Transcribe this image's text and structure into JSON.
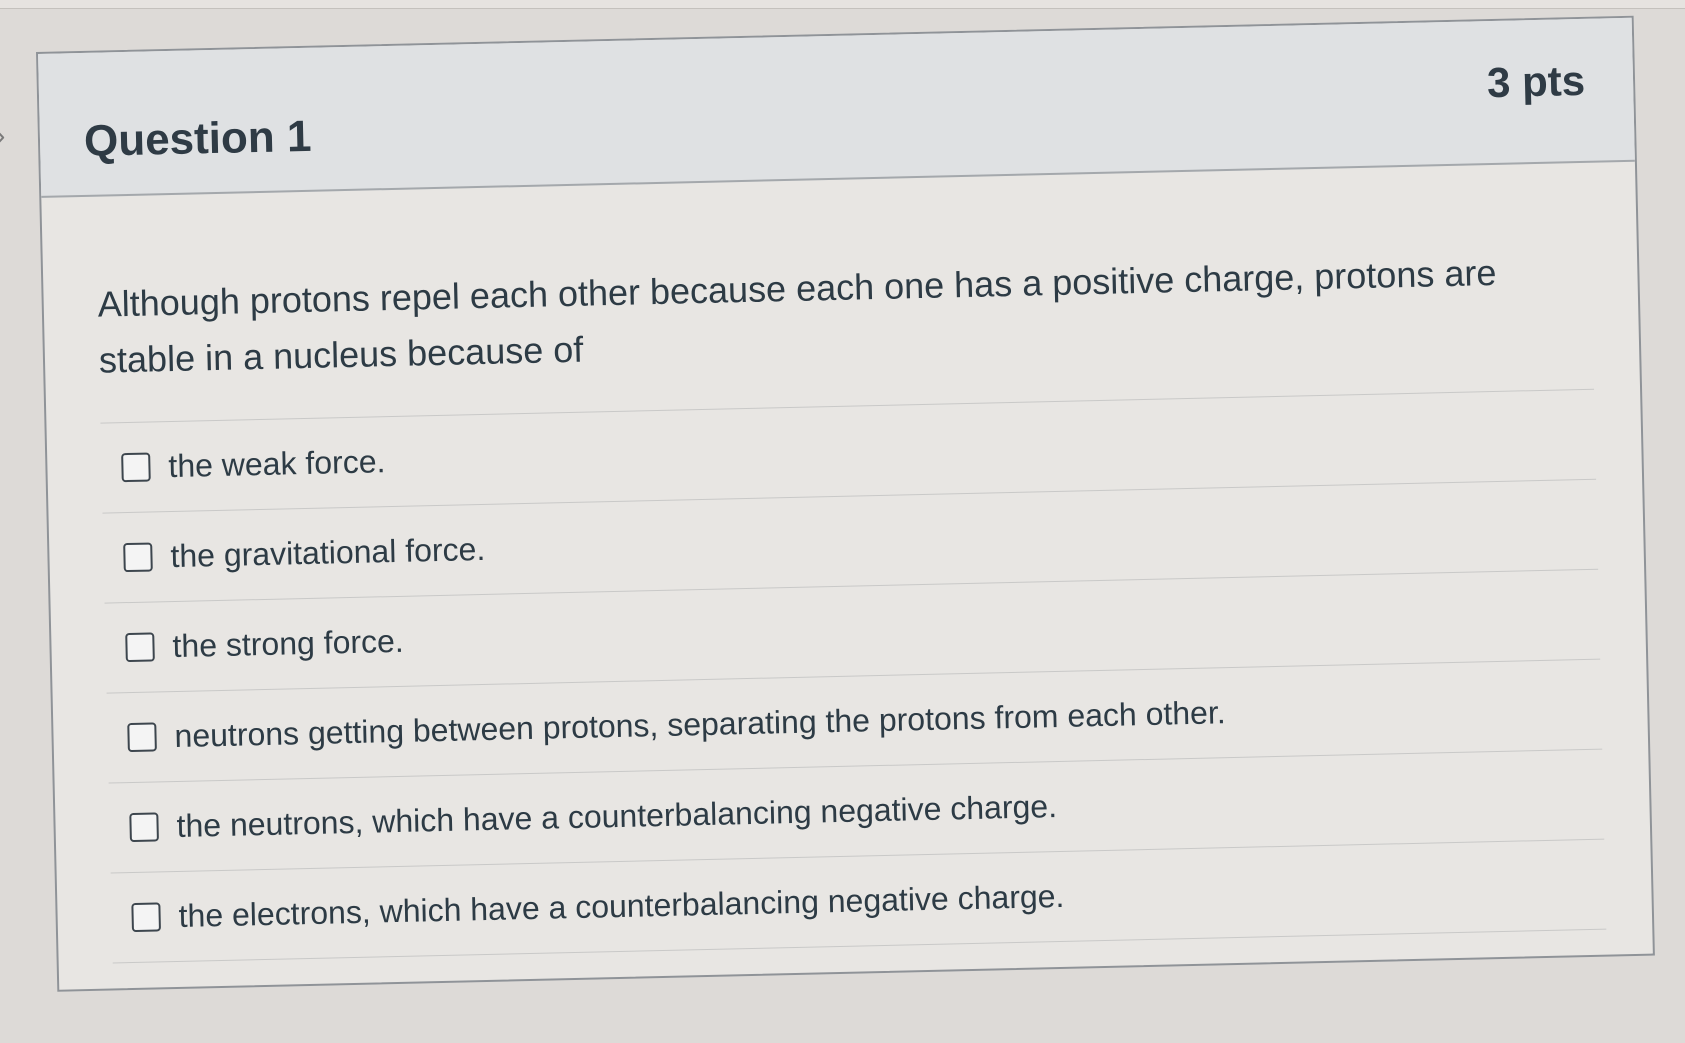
{
  "question": {
    "title": "Question 1",
    "points": "3 pts",
    "text": "Although protons repel each other because each one has a positive charge, protons are stable in a nucleus because of",
    "answers": [
      {
        "label": "the weak force.",
        "checked": false
      },
      {
        "label": "the gravitational force.",
        "checked": false
      },
      {
        "label": "the strong force.",
        "checked": false
      },
      {
        "label": "neutrons getting between protons, separating the protons from each other.",
        "checked": false
      },
      {
        "label": "the neutrons, which have a counterbalancing negative charge.",
        "checked": false
      },
      {
        "label": "the electrons, which have a counterbalancing negative charge.",
        "checked": false
      }
    ]
  },
  "colors": {
    "text": "#2d3b45",
    "header_background": "#dfe1e3",
    "card_border": "#8f9398"
  }
}
